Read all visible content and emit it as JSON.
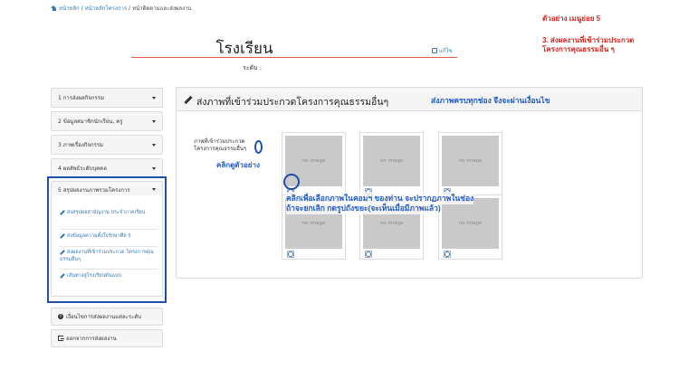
{
  "breadcrumb": {
    "home": "หน้าหลัก",
    "project_home": "หน้าหลักโครงการ",
    "current": "หน้าติดตามและส่งผลงาน"
  },
  "annotations": {
    "example_title": "ตัวอย่าง เมนูย่อย 5",
    "example_desc_1": "3. ส่งผลงานที่เข้าร่วมประกวด",
    "example_desc_2": "โครงการคุณธรรมอื่น ๆ",
    "note_complete": "ส่งภาพครบทุกช่อง จึงจะผ่านเงื่อนไข",
    "note_example": "คลิกดูตัวอย่าง",
    "note_upload_1": "คลิกเพื่อเลือกภาพในคอมฯ ของท่าน จะปรากฏภาพในช่อง",
    "note_upload_2": "ถ้าจะยกเลิก กดรูปถังขยะ(จะเห็นเมื่อมีภาพแล้ว)"
  },
  "school": {
    "title": "โรงเรียน",
    "edit_label": "แก้ไข",
    "level_label": "ระดับ :"
  },
  "sidebar": {
    "items": [
      {
        "label": "1 การส่งผลกิจกรรม"
      },
      {
        "label": "2 ข้อมูลสมาชิกนักเรียน, ครู"
      },
      {
        "label": "3 ภาพเรื่องกิจกรรม"
      },
      {
        "label": "4 ผลลัพธ์ระดับบุคคล"
      },
      {
        "label": "5 สรุปผลงานภาพรวมโครงการ"
      }
    ],
    "sub_items": [
      {
        "label": "ส่งสรุปผลสามัญงาน ประจำภาคเรียน"
      },
      {
        "label": "ส่งข้อมูลความตั้งใจรักษาศีล 5"
      },
      {
        "label": "ส่งผลงานที่เข้าร่วมประกวด โครงการคุณธรรมอื่นๆ"
      },
      {
        "label": "เส้นทางสู่โรงเรียนต้นแบบ"
      }
    ],
    "conditions_button": "เงื่อนไขการส่งผลงานแต่ละระดับ",
    "logout_button": "ออกจากการส่งผลงาน"
  },
  "panel": {
    "title": "ส่งภาพที่เข้าร่วมประกวดโครงการคุณธรรมอื่นๆ",
    "field_label": "ภาพที่เข้าร่วมประกวดโครงการคุณธรรมอื่นๆ",
    "placeholder_text": "no image",
    "image_slots": 6
  }
}
